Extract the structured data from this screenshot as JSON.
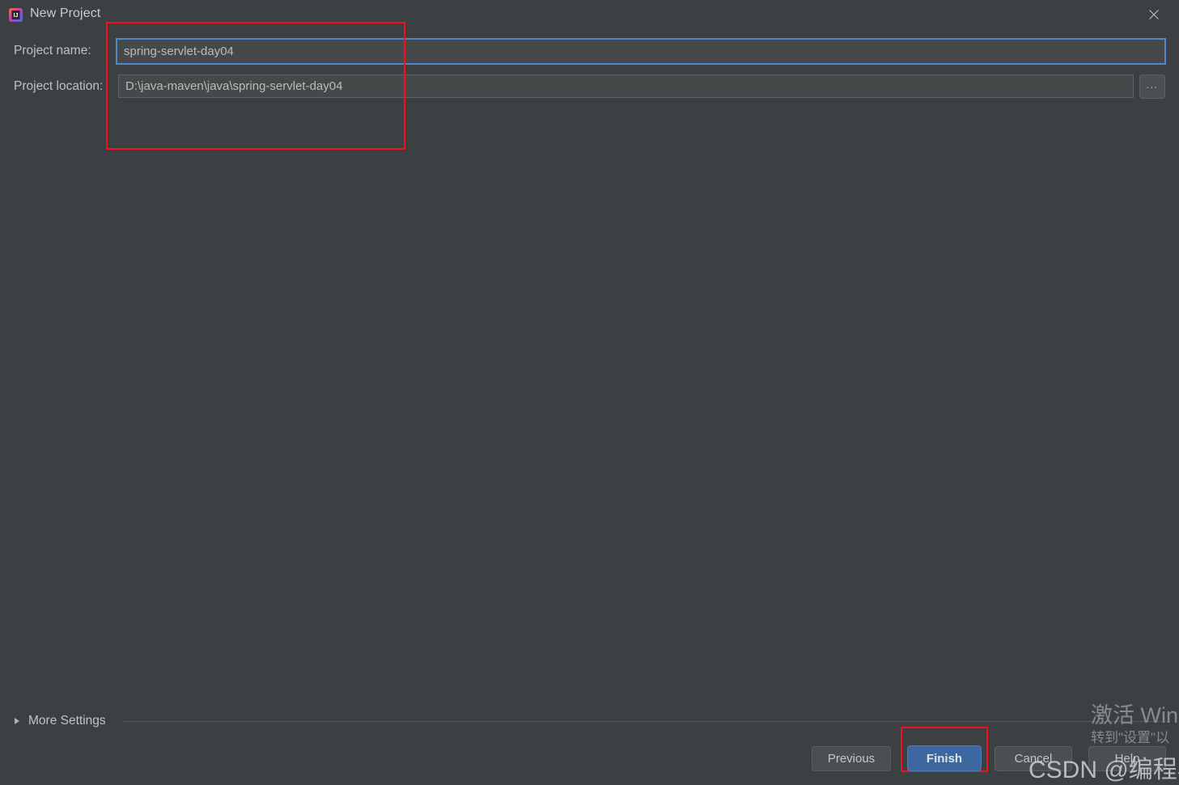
{
  "window": {
    "title": "New Project",
    "app_icon": "intellij-idea-icon",
    "close_icon": "close-icon"
  },
  "form": {
    "name_label": "Project name:",
    "name_value": "spring-servlet-day04",
    "name_placeholder": "Project name",
    "location_label": "Project location:",
    "location_value": "D:\\java-maven\\java\\spring-servlet-day04",
    "location_placeholder": "Project location",
    "browse_label": "...",
    "browse_icon": "ellipsis-icon"
  },
  "more_settings": {
    "label": "More Settings",
    "arrow_icon": "chevron-right-icon",
    "expanded": false
  },
  "buttons": {
    "previous": "Previous",
    "finish": "Finish",
    "cancel": "Cancel",
    "help": "Help"
  },
  "annotations": {
    "fields_box": "red-highlight-box",
    "finish_box": "red-highlight-box",
    "color": "#fc0d1b"
  },
  "watermarks": {
    "windows_line1": "激活 Win",
    "windows_line2": "转到\"设置\"以",
    "csdn": "CSDN @编程小大白"
  },
  "colors": {
    "background": "#3c4043",
    "field_background": "#45494a",
    "focus_border": "#4a88c7",
    "primary_button": "#3c689f",
    "text": "#bbbbbb"
  }
}
